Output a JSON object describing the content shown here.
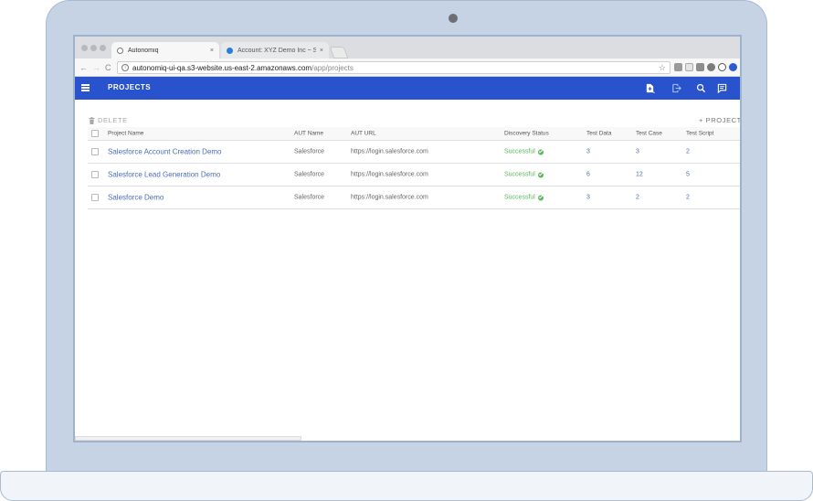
{
  "browser": {
    "tabs": [
      {
        "title": "Autonomiq",
        "close": "×"
      },
      {
        "title": "Account: XYZ Demo Inc ~ Sale",
        "close": "×"
      }
    ],
    "url_host": "autonomiq-ui-qa.s3-website.us-east-2.amazonaws.com",
    "url_path": "/app/projects",
    "nav": {
      "back": "←",
      "forward": "→",
      "reload": "C"
    },
    "star": "☆"
  },
  "app": {
    "title": "PROJECTS",
    "toolbar": {
      "delete_label": "DELETE",
      "add_project_label": "+ PROJECT"
    },
    "table": {
      "columns": [
        "Project Name",
        "AUT Name",
        "AUT URL",
        "Discovery Status",
        "Test Data",
        "Test Case",
        "Test Script"
      ],
      "rows": [
        {
          "name": "Salesforce Account Creation Demo",
          "aut_name": "Salesforce",
          "aut_url": "https://login.salesforce.com",
          "status": "Successful",
          "test_data": "3",
          "test_case": "3",
          "test_script": "2"
        },
        {
          "name": "Salesforce Lead Generation Demo",
          "aut_name": "Salesforce",
          "aut_url": "https://login.salesforce.com",
          "status": "Successful",
          "test_data": "6",
          "test_case": "12",
          "test_script": "5"
        },
        {
          "name": "Salesforce Demo",
          "aut_name": "Salesforce",
          "aut_url": "https://login.salesforce.com",
          "status": "Successful",
          "test_data": "3",
          "test_case": "2",
          "test_script": "2"
        }
      ]
    },
    "colors": {
      "header": "#2953cc",
      "success": "#5bb85b",
      "link": "#4a6fb0"
    }
  }
}
